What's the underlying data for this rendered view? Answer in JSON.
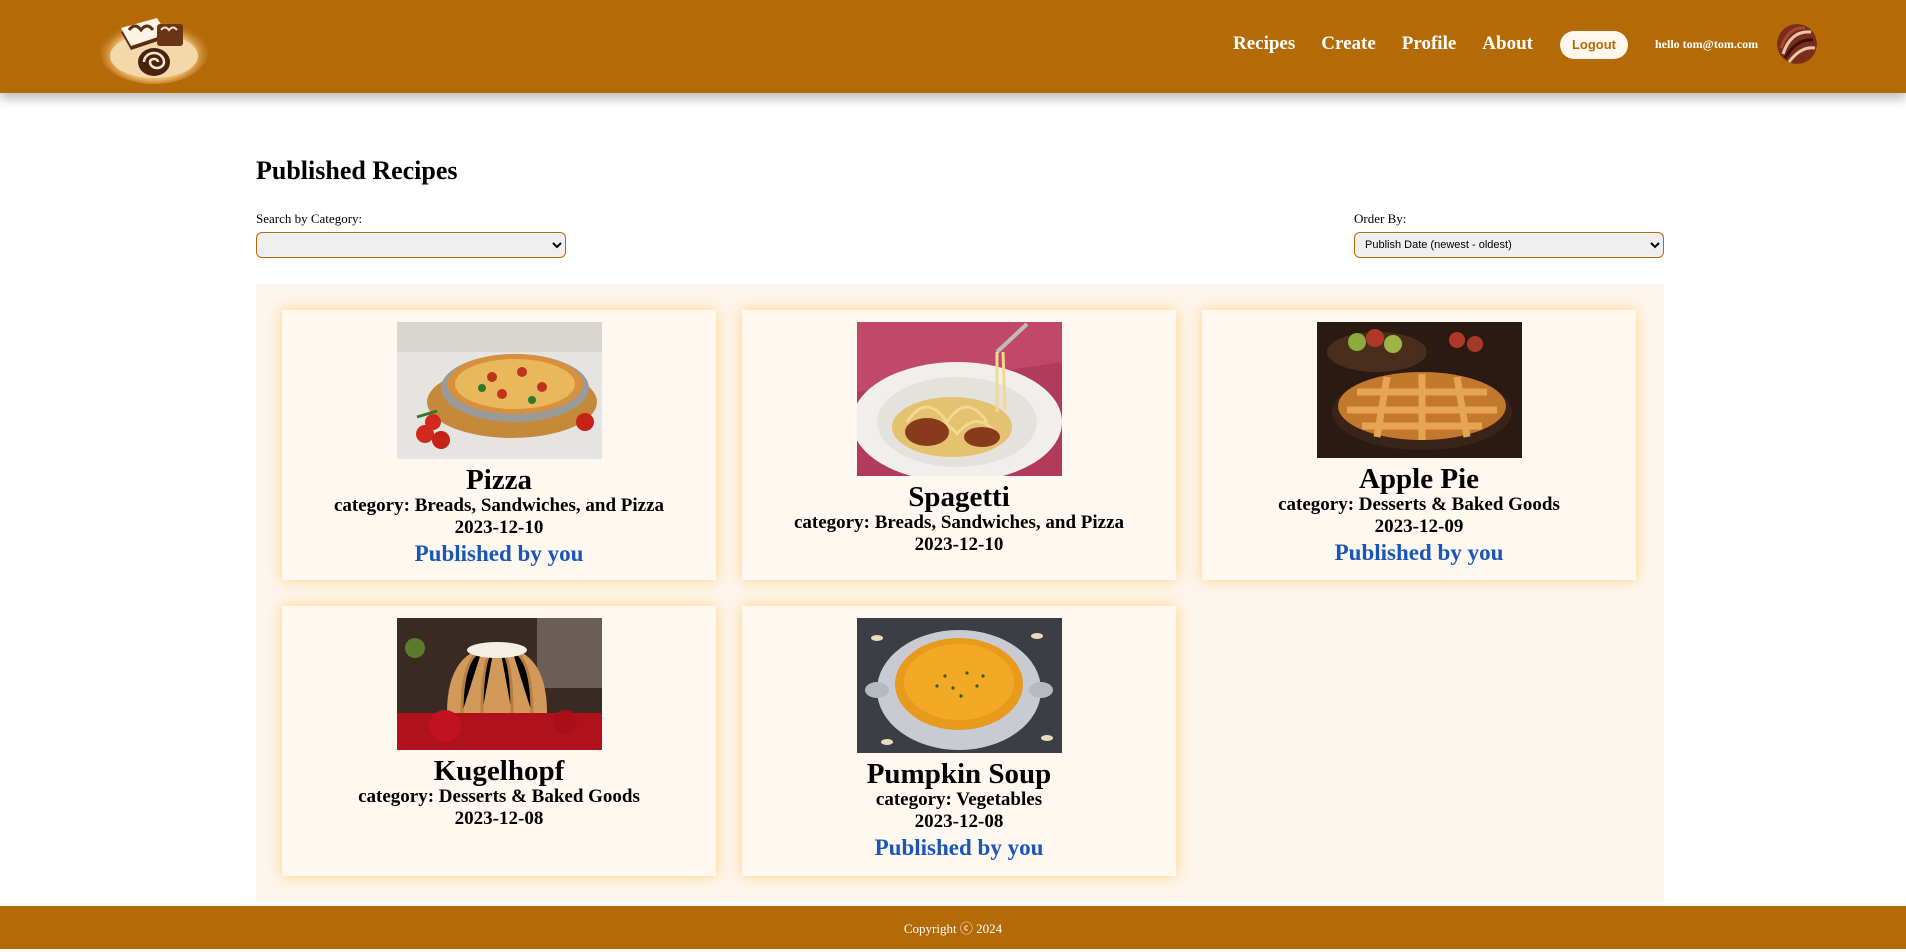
{
  "nav": {
    "recipes": "Recipes",
    "create": "Create",
    "profile": "Profile",
    "about": "About",
    "logout": "Logout",
    "greeting": "hello tom@tom.com"
  },
  "page": {
    "title": "Published Recipes"
  },
  "filters": {
    "category_label": "Search by Category:",
    "category_value": "",
    "order_label": "Order By:",
    "order_value": "Publish Date (newest - oldest)"
  },
  "recipes": [
    {
      "title": "Pizza",
      "category": "category: Breads, Sandwiches, and Pizza",
      "date": "2023-12-10",
      "published": "Published by you"
    },
    {
      "title": "Spagetti",
      "category": "category: Breads, Sandwiches, and Pizza",
      "date": "2023-12-10",
      "published": ""
    },
    {
      "title": "Apple Pie",
      "category": "category: Desserts & Baked Goods",
      "date": "2023-12-09",
      "published": "Published by you"
    },
    {
      "title": "Kugelhopf",
      "category": "category: Desserts & Baked Goods",
      "date": "2023-12-08",
      "published": ""
    },
    {
      "title": "Pumpkin Soup",
      "category": "category: Vegetables",
      "date": "2023-12-08",
      "published": "Published by you"
    }
  ],
  "footer": {
    "copyright": "Copyright ⓒ 2024"
  },
  "colors": {
    "brand": "#b46a07",
    "link_blue": "#1a56b8",
    "card_bg": "#fff8f1"
  }
}
